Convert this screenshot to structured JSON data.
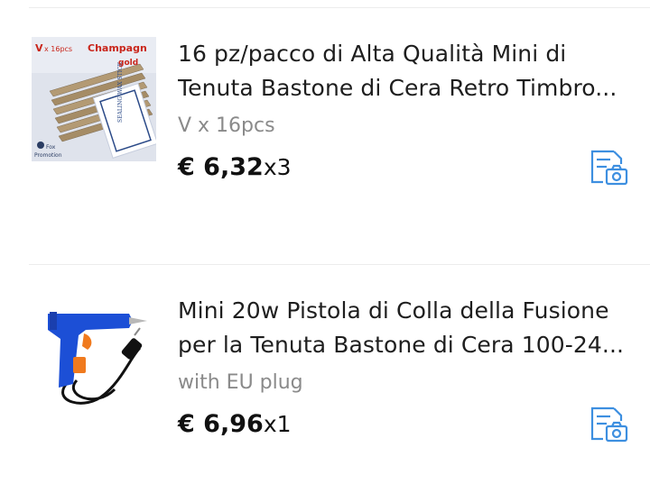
{
  "colors": {
    "accent": "#3d8fe0",
    "variant_text": "#8a8a8a",
    "divider": "#ececec"
  },
  "items": [
    {
      "title": "16 pz/pacco di Alta Qualità Mini di Tenuta Bastone di Cera Retro Timbro...",
      "variant": "V x 16pcs",
      "price": "€ 6,32",
      "qty": "x3",
      "image_text": {
        "tag": "V",
        "count": "x 16pcs",
        "color_name": "Champagn",
        "color_sub": "gold",
        "brand": "Fox",
        "brand_sub": "Promotion",
        "seal_label": "SEALING WAX STICK"
      },
      "icon": "add-to-cart-icon"
    },
    {
      "title": "Mini 20w Pistola di Colla della Fusione per la Tenuta Bastone di Cera 100-24...",
      "variant": "with EU plug",
      "price": "€ 6,96",
      "qty": "x1",
      "icon": "add-to-cart-icon"
    }
  ]
}
